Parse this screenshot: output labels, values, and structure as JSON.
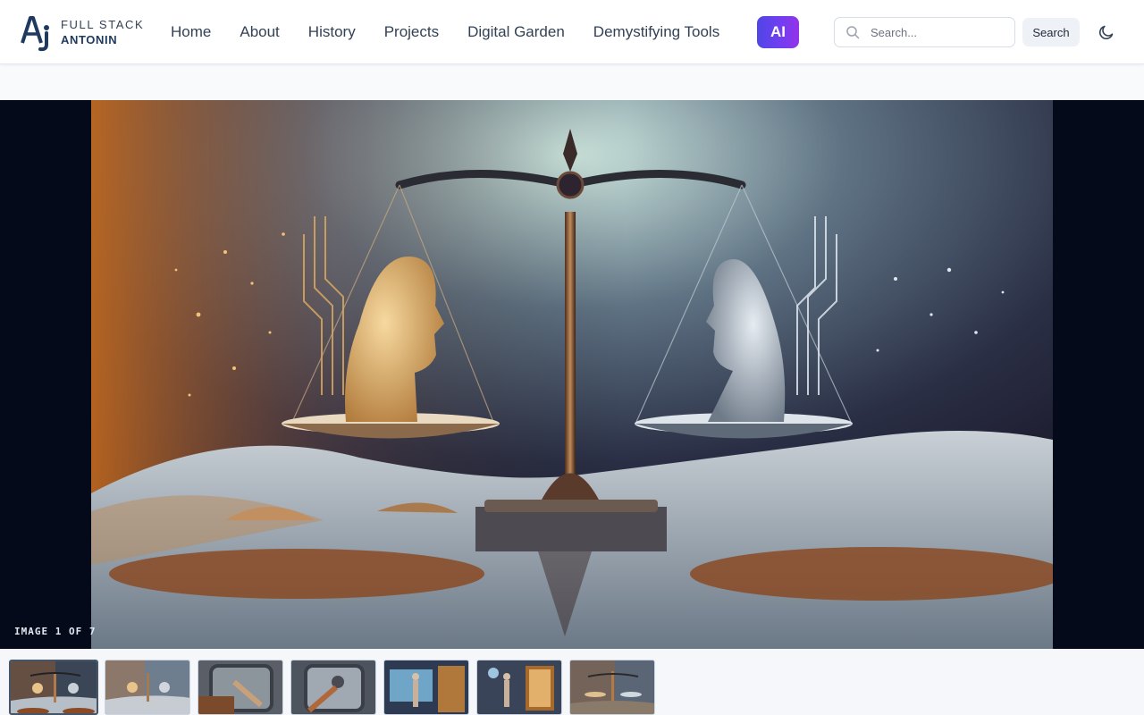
{
  "logo": {
    "line1": "FULL STACK",
    "line2": "ANTONIN",
    "mark_icon": "aj-monogram-icon"
  },
  "nav": {
    "items": [
      {
        "label": "Home"
      },
      {
        "label": "About"
      },
      {
        "label": "History"
      },
      {
        "label": "Projects"
      },
      {
        "label": "Digital Garden"
      },
      {
        "label": "Demystifying Tools"
      }
    ],
    "ai_label": "AI"
  },
  "search": {
    "placeholder": "Search...",
    "value": "",
    "button_label": "Search",
    "icon": "search-icon"
  },
  "theme_toggle": {
    "icon": "moon-icon"
  },
  "gallery": {
    "counter": "IMAGE 1 OF 7",
    "current_index": 1,
    "total": 7,
    "thumbnails": [
      {
        "active": true
      },
      {
        "active": false
      },
      {
        "active": false
      },
      {
        "active": false
      },
      {
        "active": false
      },
      {
        "active": false
      },
      {
        "active": false
      }
    ]
  },
  "colors": {
    "accent_gradient_start": "#4f46e5",
    "accent_gradient_end": "#9333ea",
    "viewer_background": "#050a1a",
    "header_background": "#ffffff",
    "page_background": "#f8fafc"
  }
}
